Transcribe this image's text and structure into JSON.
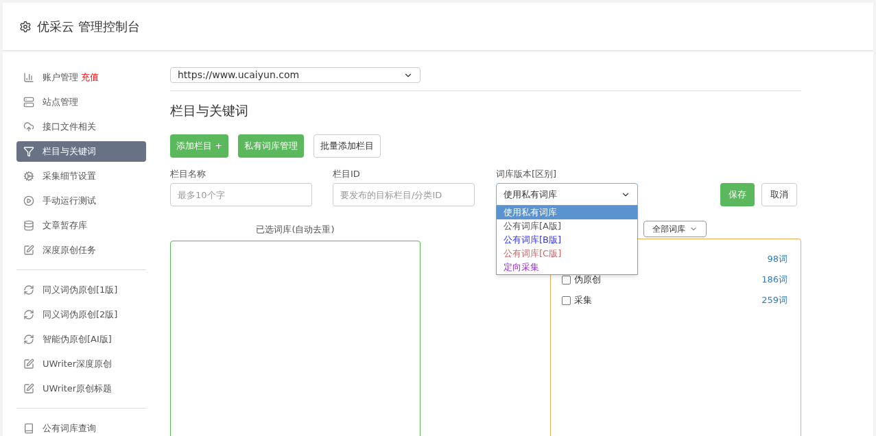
{
  "header": {
    "title": "优采云 管理控制台"
  },
  "sidebar": {
    "groups": [
      [
        {
          "label": "账户管理",
          "badge": "充值",
          "selected": false
        },
        {
          "label": "站点管理",
          "selected": false
        },
        {
          "label": "接口文件相关",
          "selected": false
        },
        {
          "label": "栏目与关键词",
          "selected": true
        },
        {
          "label": "采集细节设置",
          "selected": false
        },
        {
          "label": "手动运行测试",
          "selected": false
        },
        {
          "label": "文章暂存库",
          "selected": false
        },
        {
          "label": "深度原创任务",
          "selected": false
        }
      ],
      [
        {
          "label": "同义词伪原创[1版]",
          "selected": false
        },
        {
          "label": "同义词伪原创[2版]",
          "selected": false
        },
        {
          "label": "智能伪原创[AI版]",
          "selected": false
        },
        {
          "label": "UWriter深度原创",
          "selected": false
        },
        {
          "label": "UWriter原创标题",
          "selected": false
        }
      ],
      [
        {
          "label": "公有词库查询",
          "selected": false
        }
      ]
    ]
  },
  "site_select": {
    "value": "https://www.ucaiyun.com"
  },
  "section_title": "栏目与关键词",
  "toolbar": [
    {
      "label": "添加栏目 +",
      "kind": "primary"
    },
    {
      "label": "私有词库管理",
      "kind": "primary"
    },
    {
      "label": "批量添加栏目",
      "kind": "default"
    }
  ],
  "form": {
    "name_field": {
      "label": "栏目名称",
      "placeholder": "最多10个字"
    },
    "id_field": {
      "label": "栏目ID",
      "placeholder": "要发布的目标栏目/分类ID"
    },
    "version_select": {
      "label": "词库版本[区别]",
      "value": "使用私有词库",
      "expanded": true,
      "options": [
        {
          "label": "使用私有词库",
          "selected": true
        },
        {
          "label": "公有词库[A版]",
          "selected": false,
          "color": "#555555"
        },
        {
          "label": "公有词库[B版]",
          "selected": false,
          "color": "#3333ff"
        },
        {
          "label": "公有词库[C版]",
          "selected": false,
          "color": "#cc6666"
        },
        {
          "label": "定向采集",
          "selected": false,
          "color": "#9933cc"
        }
      ]
    },
    "save": "保存",
    "cancel": "取消"
  },
  "selected_panel": {
    "title": "已选词库(自动去重)"
  },
  "library_filter": {
    "value": "全部词库"
  },
  "libraries": [
    {
      "count": "98词"
    },
    {
      "label": "伪原创",
      "count": "186词",
      "checked": false
    },
    {
      "label": "采集",
      "count": "259词",
      "checked": false
    }
  ]
}
